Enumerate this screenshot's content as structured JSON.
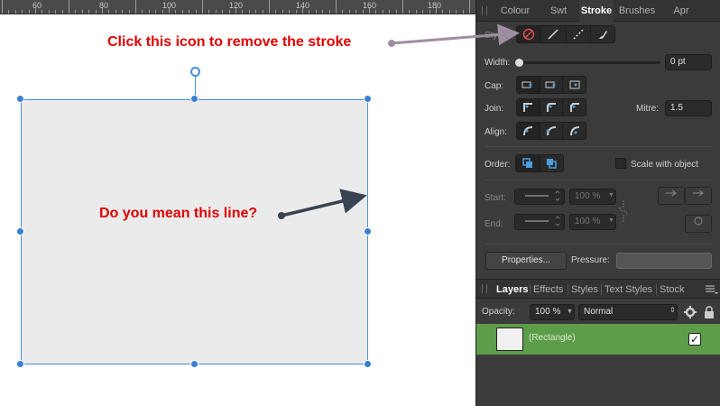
{
  "ruler": {
    "labels": [
      "60",
      "80",
      "100",
      "120",
      "140",
      "160",
      "180"
    ]
  },
  "annotations": {
    "stroke_hint": "Click this icon to remove the stroke",
    "line_hint": "Do you mean this line?",
    "color": "#e00000"
  },
  "panel": {
    "tabs": [
      "Colour",
      "Swt",
      "Stroke",
      "Brushes",
      "Apr"
    ],
    "active_tab": "Stroke",
    "style_label": "Style:",
    "width_label": "Width:",
    "width_value": "0 pt",
    "cap_label": "Cap:",
    "join_label": "Join:",
    "mitre_label": "Mitre:",
    "mitre_value": "1.5",
    "align_label": "Align:",
    "order_label": "Order:",
    "scale_label": "Scale with object",
    "start_label": "Start:",
    "start_percent": "100 %",
    "end_label": "End:",
    "end_percent": "100 %",
    "properties_label": "Properties...",
    "pressure_label": "Pressure:"
  },
  "layers": {
    "tabs": [
      "Layers",
      "Effects",
      "Styles",
      "Text Styles",
      "Stock"
    ],
    "active_tab": "Layers",
    "opacity_label": "Opacity:",
    "opacity_value": "100 %",
    "blend_mode": "Normal",
    "layer_name": "(Rectangle)",
    "layer_checked": "✓",
    "layer_color": "#5d9d4a"
  }
}
